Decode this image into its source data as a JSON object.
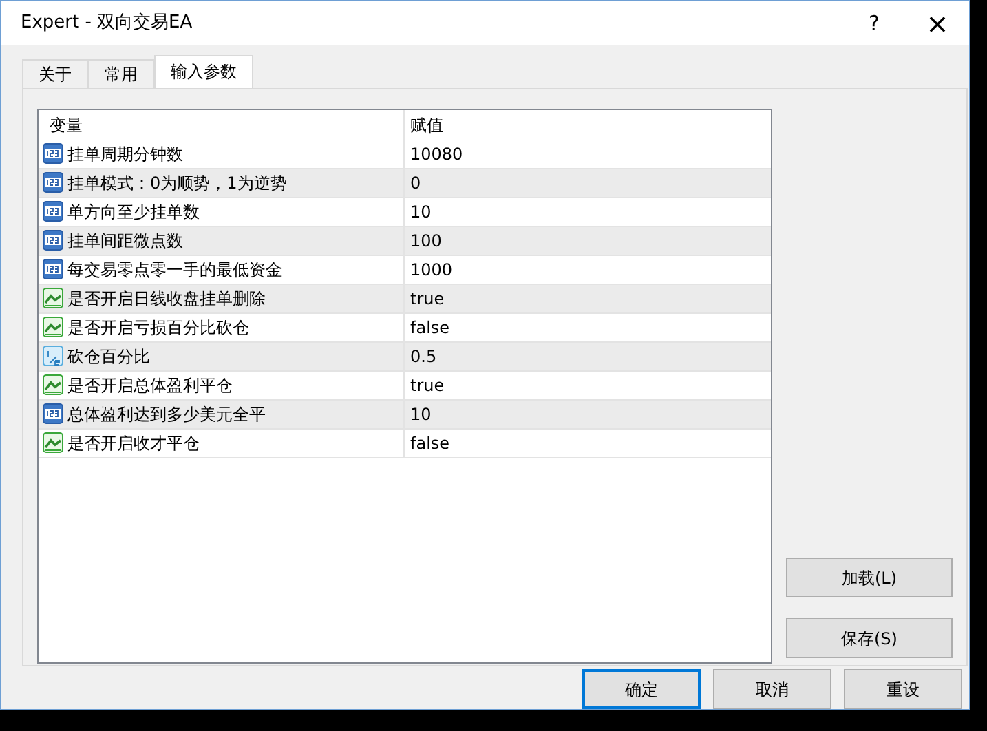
{
  "window": {
    "title": "Expert - 双向交易EA",
    "help": "?",
    "close": "×"
  },
  "tabs": [
    {
      "label": "关于",
      "selected": false
    },
    {
      "label": "常用",
      "selected": false
    },
    {
      "label": "输入参数",
      "selected": true
    }
  ],
  "table": {
    "columns": [
      "变量",
      "赋值"
    ],
    "rows": [
      {
        "kind": "int",
        "name": "挂单周期分钟数",
        "value": "10080"
      },
      {
        "kind": "int",
        "name": "挂单模式：0为顺势，1为逆势",
        "value": "0"
      },
      {
        "kind": "int",
        "name": "单方向至少挂单数",
        "value": "10"
      },
      {
        "kind": "int",
        "name": "挂单间距微点数",
        "value": "100"
      },
      {
        "kind": "int",
        "name": "每交易零点零一手的最低资金",
        "value": "1000"
      },
      {
        "kind": "bool",
        "name": "是否开启日线收盘挂单删除",
        "value": "true"
      },
      {
        "kind": "bool",
        "name": "是否开启亏损百分比砍仓",
        "value": "false"
      },
      {
        "kind": "double",
        "name": "砍仓百分比",
        "value": "0.5"
      },
      {
        "kind": "bool",
        "name": "是否开启总体盈利平仓",
        "value": "true"
      },
      {
        "kind": "int",
        "name": "总体盈利达到多少美元全平",
        "value": "10"
      },
      {
        "kind": "bool",
        "name": "是否开启收才平仓",
        "value": "false"
      }
    ]
  },
  "side_buttons": [
    "加载(L)",
    "保存(S)"
  ],
  "footer_buttons": [
    {
      "label": "确定",
      "default": true
    },
    {
      "label": "取消",
      "default": false
    },
    {
      "label": "重设",
      "default": false
    }
  ]
}
